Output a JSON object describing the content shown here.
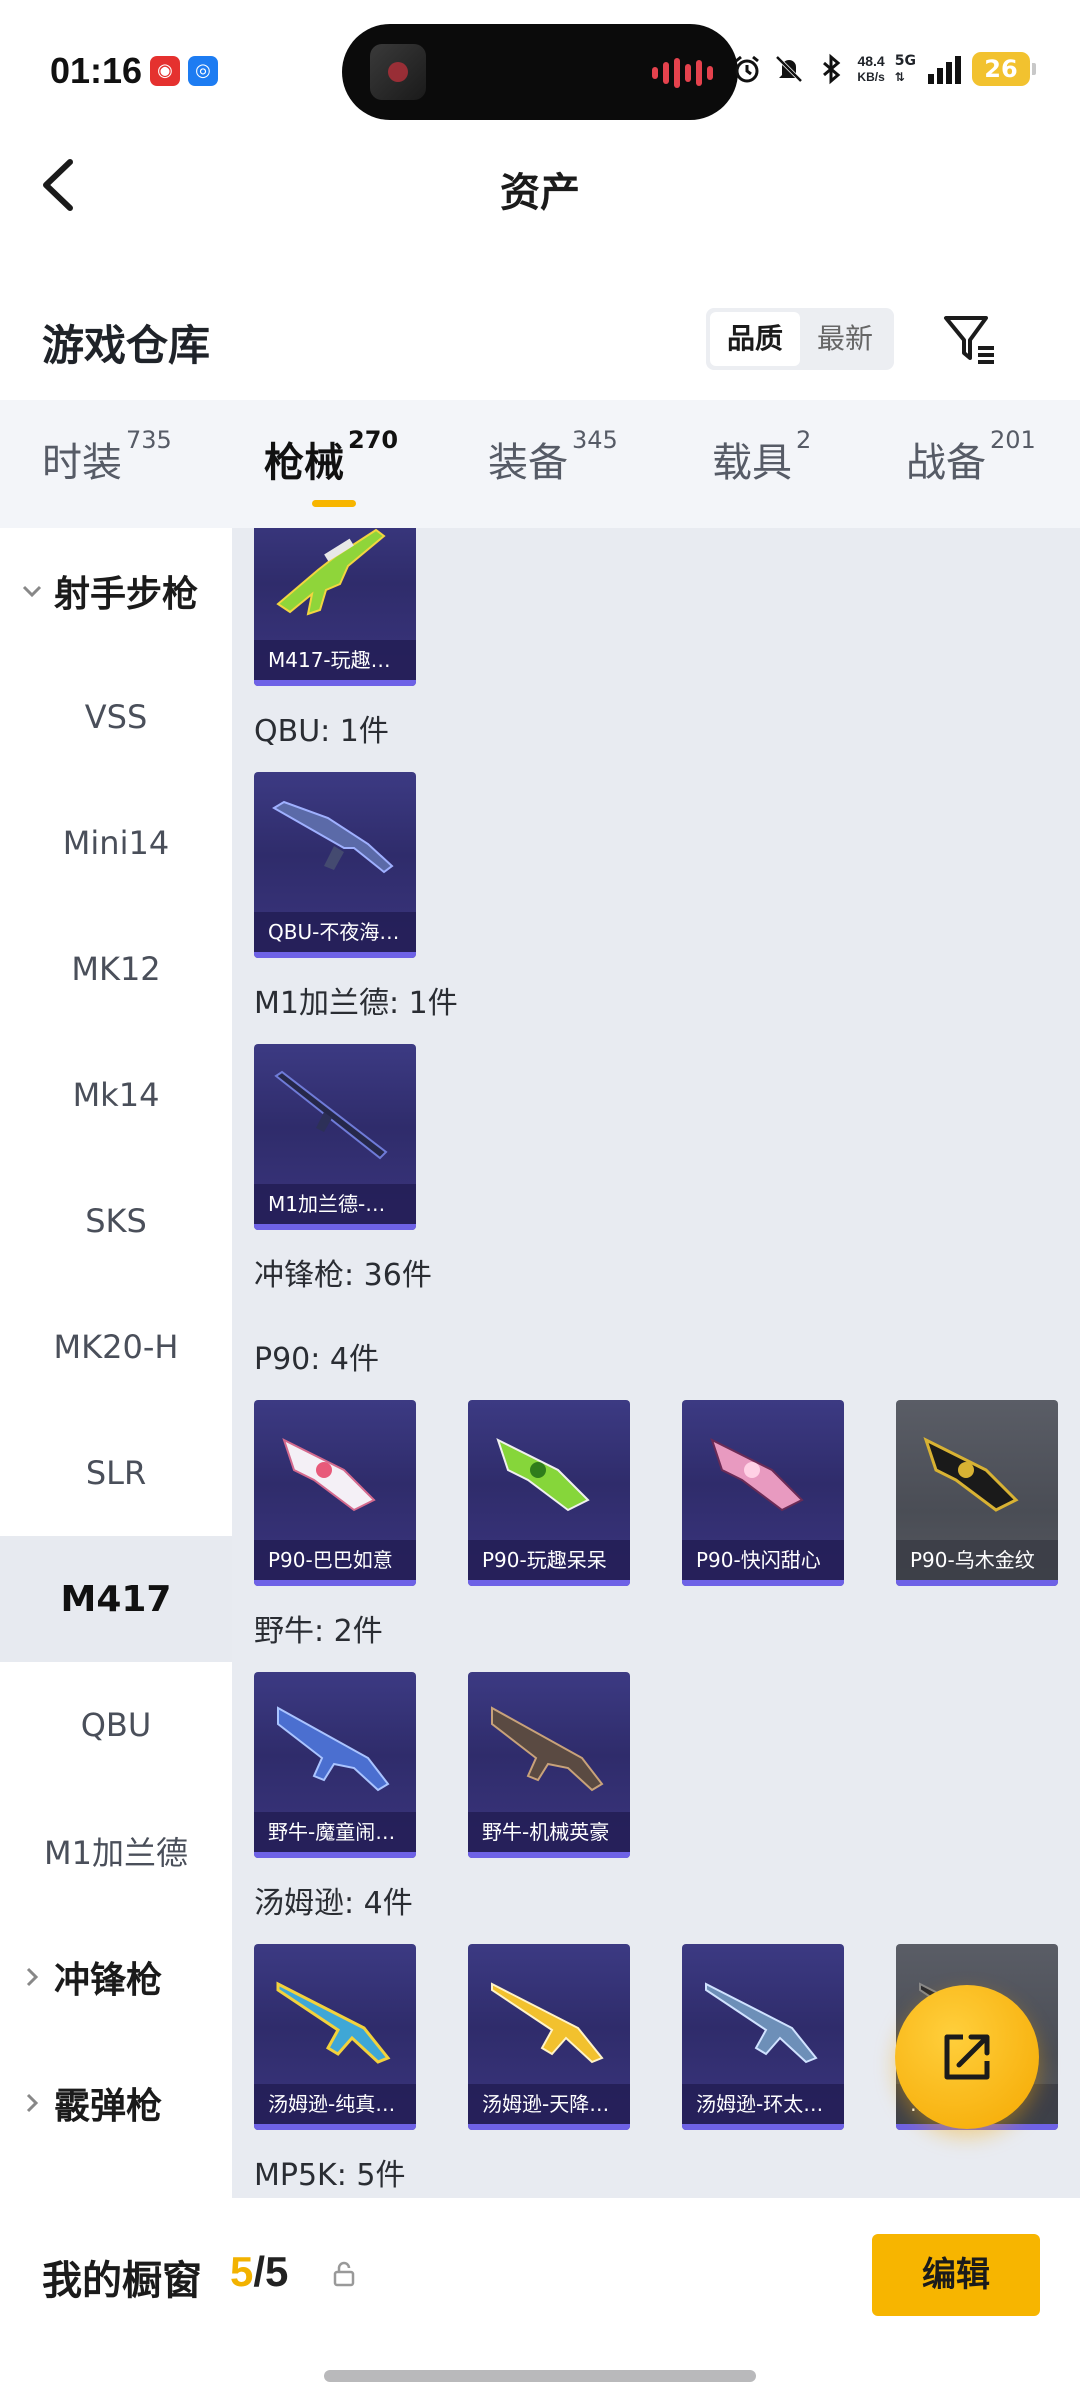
{
  "status": {
    "time": "01:16",
    "speed": "48.4",
    "speed_unit": "KB/s",
    "network": "5G",
    "battery": "26",
    "icons": [
      "netease-music-icon",
      "browser-icon",
      "alarm-icon",
      "mute-icon",
      "bluetooth-icon",
      "signal-icon"
    ]
  },
  "header": {
    "title": "资产"
  },
  "warehouse": {
    "title": "游戏仓库",
    "sort_options": [
      "品质",
      "最新"
    ],
    "active_sort": "品质"
  },
  "tabs": [
    {
      "label": "时装",
      "count": "735"
    },
    {
      "label": "枪械",
      "count": "270",
      "active": true
    },
    {
      "label": "装备",
      "count": "345"
    },
    {
      "label": "载具",
      "count": "2"
    },
    {
      "label": "战备",
      "count": "201"
    }
  ],
  "sidebar": {
    "group_open": "射手步枪",
    "items": [
      "VSS",
      "Mini14",
      "MK12",
      "Mk14",
      "SKS",
      "MK20-H",
      "SLR",
      "M417",
      "QBU",
      "M1加兰德"
    ],
    "active_item": "M417",
    "group_closed_1": "冲锋枪",
    "group_closed_2": "霰弹枪"
  },
  "content": {
    "sections": [
      "QBU: 1件",
      "M1加兰德: 1件",
      "冲锋枪: 36件",
      "P90: 4件",
      "野牛: 2件",
      "汤姆逊: 4件",
      "MP5K: 5件"
    ],
    "items": {
      "m417": [
        "M417-玩趣…"
      ],
      "qbu": [
        "QBU-不夜海…"
      ],
      "m1": [
        "M1加兰德-…"
      ],
      "p90": [
        "P90-巴巴如意",
        "P90-玩趣呆呆",
        "P90-快闪甜心",
        "P90-乌木金纹"
      ],
      "bison": [
        "野牛-魔童闹…",
        "野牛-机械英豪"
      ],
      "thompson": [
        "汤姆逊-纯真…",
        "汤姆逊-天降…",
        "汤姆逊-环太…",
        "…"
      ]
    },
    "accent_colors": {
      "card_bg": "#3c3a83",
      "card_bar": "#6e62e6",
      "grey_card": "#5a5d66"
    }
  },
  "bottom": {
    "label": "我的橱窗",
    "count_current": "5",
    "count_sep": "/",
    "count_total": "5",
    "edit": "编辑"
  },
  "colors": {
    "accent": "#f7b500"
  }
}
